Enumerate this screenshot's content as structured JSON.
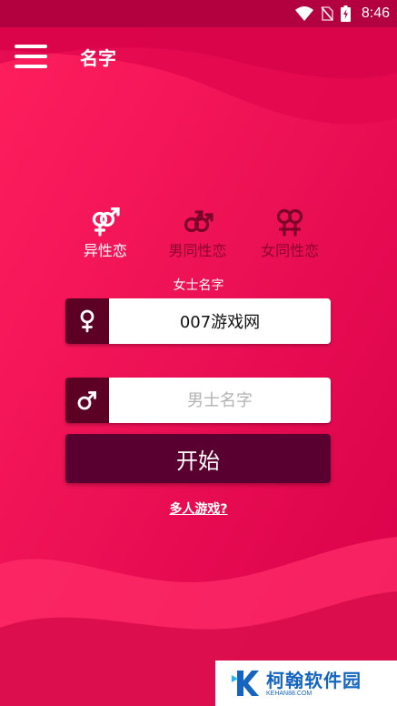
{
  "status_bar": {
    "time": "8:46"
  },
  "app_bar": {
    "title": "名字"
  },
  "modes": [
    {
      "label": "异性恋",
      "icon": "hetero-gender-icon",
      "active": true
    },
    {
      "label": "男同性恋",
      "icon": "gay-gender-icon",
      "active": false
    },
    {
      "label": "女同性恋",
      "icon": "lesbian-gender-icon",
      "active": false
    }
  ],
  "form": {
    "female_caption": "女士名字",
    "female_value": "007游戏网",
    "male_value": "",
    "male_placeholder": "男士名字",
    "start_label": "开始"
  },
  "multiplayer_link": "多人游戏?",
  "watermark": {
    "name": "柯翰软件园",
    "url": "KEHAN88.COM"
  },
  "colors": {
    "accent": "#e0064f",
    "dark_button": "#5a0030",
    "icon_box": "#5c0024",
    "watermark_blue": "#1565c0"
  }
}
